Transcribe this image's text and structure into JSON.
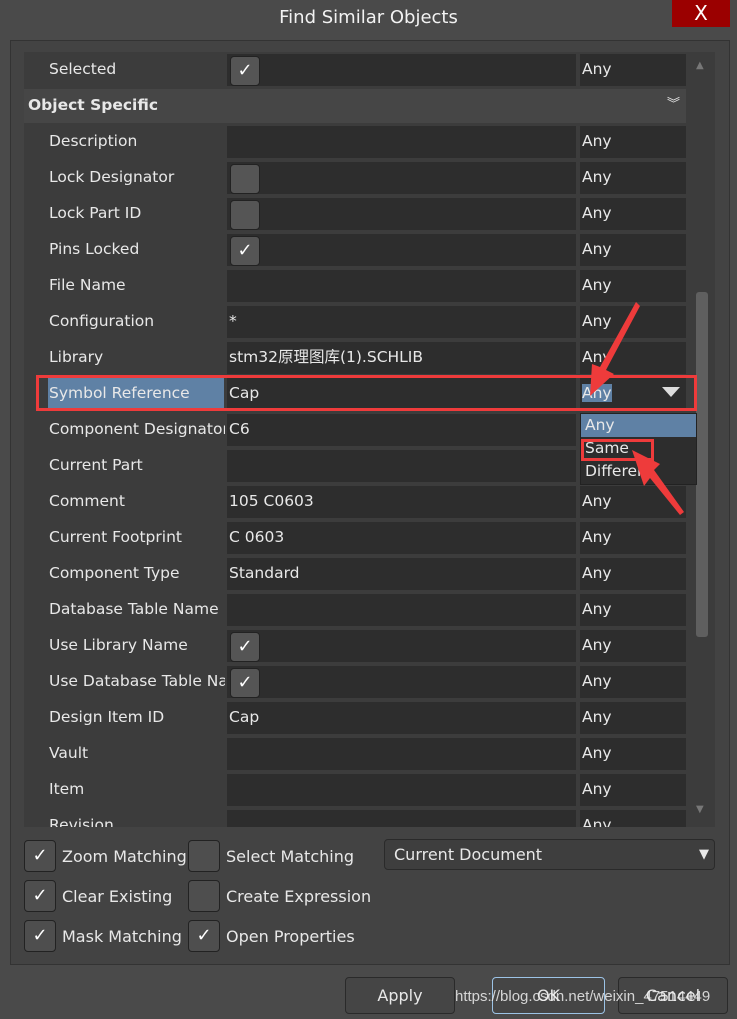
{
  "window": {
    "title": "Find Similar Objects",
    "close_label": "X"
  },
  "grid": {
    "selected_row": {
      "label": "Selected",
      "value": "",
      "checkbox": true,
      "match": "Any"
    },
    "section_header": "Object Specific",
    "rows": [
      {
        "label": "Description",
        "value": "",
        "match": "Any"
      },
      {
        "label": "Lock Designator",
        "checkbox": false,
        "value": "",
        "match": "Any"
      },
      {
        "label": "Lock Part ID",
        "checkbox": false,
        "value": "",
        "match": "Any"
      },
      {
        "label": "Pins Locked",
        "checkbox": true,
        "value": "",
        "match": "Any"
      },
      {
        "label": "File Name",
        "value": "",
        "match": "Any"
      },
      {
        "label": "Configuration",
        "value": "*",
        "match": "Any"
      },
      {
        "label": "Library",
        "value": "stm32原理图库(1).SCHLIB",
        "match": "Any"
      },
      {
        "label": "Symbol Reference",
        "value": "Cap",
        "match": "Any",
        "selected": true
      },
      {
        "label": "Component Designator",
        "value": "C6",
        "match": "Any"
      },
      {
        "label": "Current Part",
        "value": "",
        "match": "Any"
      },
      {
        "label": "Comment",
        "value": "105 C0603",
        "match": "Any"
      },
      {
        "label": "Current Footprint",
        "value": "C 0603",
        "match": "Any"
      },
      {
        "label": "Component Type",
        "value": "Standard",
        "match": "Any"
      },
      {
        "label": "Database Table Name",
        "value": "",
        "match": "Any"
      },
      {
        "label": "Use Library Name",
        "checkbox": true,
        "value": "",
        "match": "Any"
      },
      {
        "label": "Use Database Table Name",
        "checkbox": true,
        "value": "",
        "match": "Any"
      },
      {
        "label": "Design Item ID",
        "value": "Cap",
        "match": "Any"
      },
      {
        "label": "Vault",
        "value": "",
        "match": "Any"
      },
      {
        "label": "Item",
        "value": "",
        "match": "Any"
      },
      {
        "label": "Revision",
        "value": "",
        "match": "Any"
      }
    ],
    "dropdown_options": [
      "Any",
      "Same",
      "Different"
    ],
    "dropdown_highlighted": "Any"
  },
  "options": {
    "zoom_matching": {
      "label": "Zoom Matching",
      "checked": true
    },
    "select_matching": {
      "label": "Select Matching",
      "checked": false
    },
    "clear_existing": {
      "label": "Clear Existing",
      "checked": true
    },
    "create_expression": {
      "label": "Create Expression",
      "checked": false
    },
    "mask_matching": {
      "label": "Mask Matching",
      "checked": true
    },
    "open_properties": {
      "label": "Open Properties",
      "checked": true
    },
    "scope": "Current Document"
  },
  "buttons": {
    "apply": "Apply",
    "ok": "OK",
    "cancel": "Cancel"
  },
  "watermark": "https://blog.csdn.net/weixin_47514449",
  "colors": {
    "selection": "#5f81a5",
    "close": "#9b0000",
    "annotation": "#ee3b3b"
  }
}
